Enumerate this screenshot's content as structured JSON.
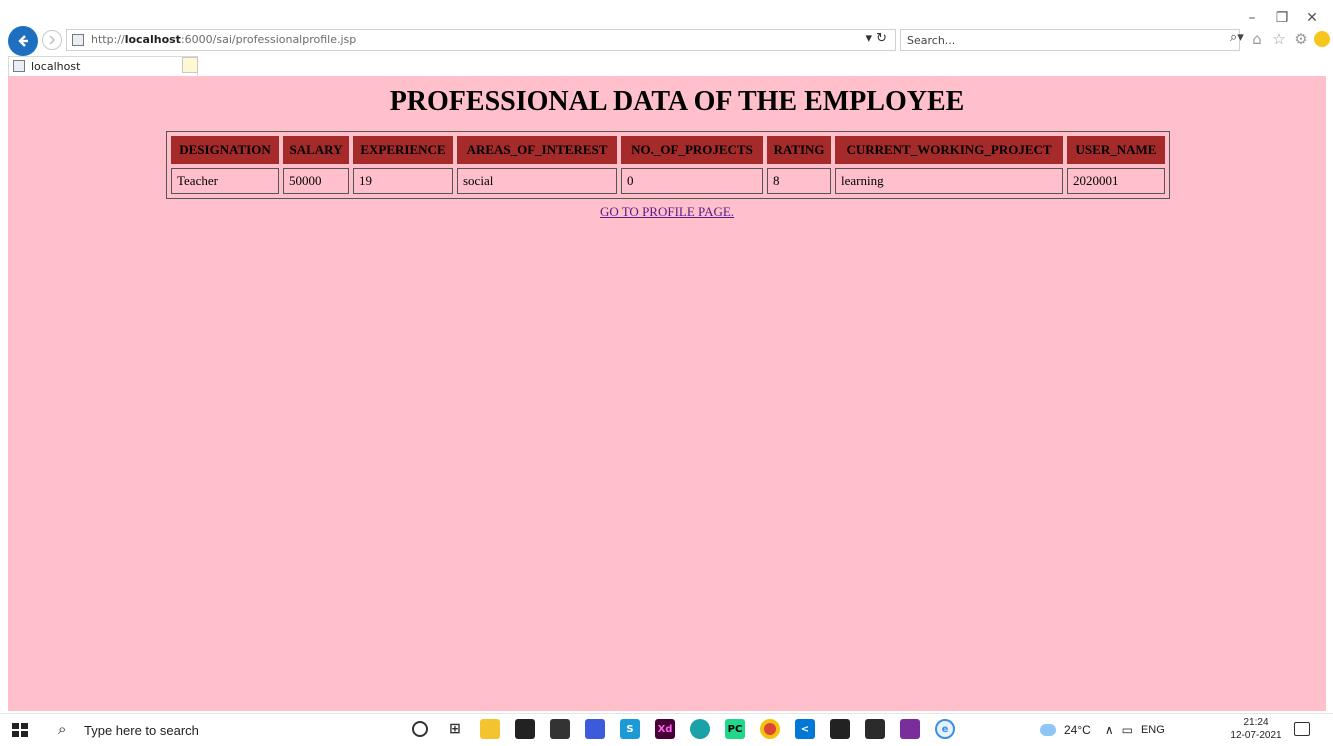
{
  "browser": {
    "url_prefix": "http://",
    "url_host": "localhost",
    "url_rest": ":6000/sai/professionalprofile.jsp",
    "search_placeholder": "Search...",
    "tab_title": "localhost",
    "window_controls": {
      "minimize": "–",
      "restore": "❐",
      "close": "✕"
    }
  },
  "page": {
    "title": "PROFESSIONAL DATA OF THE EMPLOYEE",
    "table": {
      "headers": [
        "DESIGNATION",
        "SALARY",
        "EXPERIENCE",
        "AREAS_OF_INTEREST",
        "NO._OF_PROJECTS",
        "RATING",
        "CURRENT_WORKING_PROJECT",
        "USER_NAME"
      ],
      "rows": [
        [
          "Teacher",
          "50000",
          "19",
          "social",
          "0",
          "8",
          "learning",
          "2020001"
        ]
      ]
    },
    "profile_link": "GO TO PROFILE PAGE.",
    "colors": {
      "background": "#ffc0cb",
      "header_bg": "#a52a2a",
      "link": "#551a8b"
    }
  },
  "taskbar": {
    "search_placeholder": "Type here to search",
    "weather": "24°C",
    "language": "ENG",
    "time": "21:24",
    "date": "12-07-2021",
    "apps": [
      "cortana-icon",
      "task-view-icon",
      "file-explorer-icon",
      "store-icon",
      "mail-icon",
      "app-icon",
      "skype-icon",
      "adobe-xd-icon",
      "edge-icon",
      "pycharm-icon",
      "chrome-icon",
      "vscode-icon",
      "terminal-icon",
      "photos-icon",
      "paint-icon",
      "internet-explorer-icon"
    ]
  }
}
